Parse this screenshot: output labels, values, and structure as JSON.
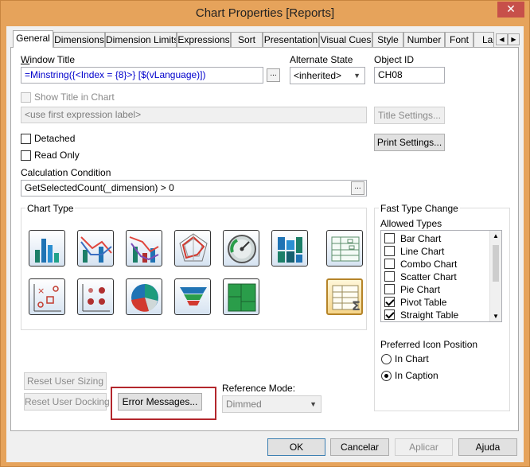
{
  "window": {
    "title": "Chart Properties [Reports]",
    "close_glyph": "✕"
  },
  "tabs": [
    "General",
    "Dimensions",
    "Dimension Limits",
    "Expressions",
    "Sort",
    "Presentation",
    "Visual Cues",
    "Style",
    "Number",
    "Font",
    "La"
  ],
  "tab_scroll": {
    "left": "◀",
    "right": "▶"
  },
  "general": {
    "window_title_label": "Window Title",
    "window_title_value": "=Minstring({<Index = {8}>} [$(vLanguage)])",
    "ellipsis": "...",
    "alternate_state_label": "Alternate State",
    "alternate_state_value": "<inherited>",
    "object_id_label": "Object ID",
    "object_id_value": "CH08",
    "show_title_label": "Show Title in Chart",
    "title_placeholder": "<use first expression label>",
    "title_settings_button": "Title Settings...",
    "detached_label": "Detached",
    "read_only_label": "Read Only",
    "print_settings_button": "Print Settings...",
    "calc_condition_label": "Calculation Condition",
    "calc_condition_value": "GetSelectedCount(_dimension) > 0",
    "chart_type_label": "Chart Type",
    "chart_types": [
      "bar-chart",
      "combo-chart",
      "line-bar-chart",
      "radar-chart",
      "gauge-chart",
      "mekko-chart",
      "pivot-table",
      "scatter-chart",
      "grid-chart",
      "pie-chart",
      "funnel-chart",
      "block-chart",
      "straight-table"
    ],
    "reset_user_sizing_button": "Reset User Sizing",
    "reset_user_docking_button": "Reset User Docking",
    "error_messages_button": "Error Messages...",
    "reference_mode_label": "Reference Mode:",
    "reference_mode_value": "Dimmed",
    "fast_type_change_label": "Fast Type Change",
    "allowed_types_label": "Allowed Types",
    "allowed_types": [
      {
        "label": "Bar Chart",
        "checked": false
      },
      {
        "label": "Line Chart",
        "checked": false
      },
      {
        "label": "Combo Chart",
        "checked": false
      },
      {
        "label": "Scatter Chart",
        "checked": false
      },
      {
        "label": "Pie Chart",
        "checked": false
      },
      {
        "label": "Pivot Table",
        "checked": true
      },
      {
        "label": "Straight Table",
        "checked": true
      }
    ],
    "preferred_icon_position_label": "Preferred Icon Position",
    "icon_position_options": [
      {
        "label": "In Chart",
        "selected": false
      },
      {
        "label": "In Caption",
        "selected": true
      }
    ]
  },
  "footer": {
    "ok": "OK",
    "cancel": "Cancelar",
    "apply": "Aplicar",
    "help": "Ajuda"
  },
  "colors": {
    "frame": "#e6a35b",
    "close": "#c7504a",
    "highlight_box": "#b3272d",
    "link_text": "#0000cc"
  }
}
